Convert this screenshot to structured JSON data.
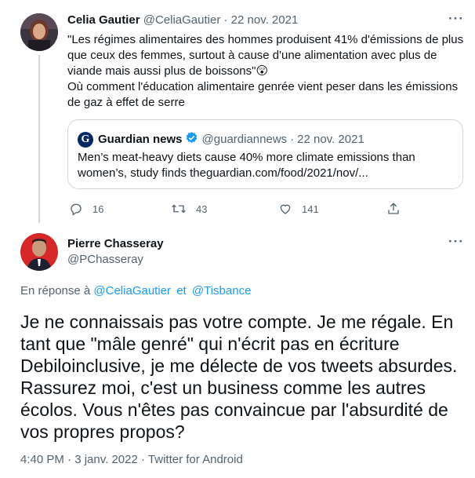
{
  "tweet1": {
    "author_name": "Celia Gautier",
    "handle": "@CeliaGautier",
    "dot": "·",
    "date": "22 nov. 2021",
    "more": "···",
    "text_lines": [
      "\"Les régimes alimentaires des hommes produisent 41% d'émissions de plus",
      "que ceux des femmes, surtout à cause d'une alimentation avec plus de",
      "viande mais aussi plus de boissons\"😲",
      "Où comment l'éducation alimentaire genrée vient peser dans les émissions",
      "de gaz à effet de serre"
    ],
    "quote": {
      "author_name": "Guardian news",
      "handle": "@guardiannews",
      "dot": "·",
      "date": "22 nov. 2021",
      "text_lines": [
        "Men’s meat-heavy diets cause 40% more climate emissions than",
        "women’s, study finds theguardian.com/food/2021/nov/..."
      ]
    },
    "actions": {
      "replies": "16",
      "retweets": "43",
      "likes": "141"
    }
  },
  "tweet2": {
    "author_name": "Pierre Chasseray",
    "handle": "@PChasseray",
    "more": "···",
    "reply_prefix": "En réponse à",
    "reply_to_1": "@CeliaGautier",
    "reply_and": "et",
    "reply_to_2": "@Tisbance",
    "text_lines": [
      "Je ne connaissais pas votre compte. Je me régale. En",
      "tant que \"mâle genré\" qui n'écrit pas en écriture",
      "Debiloinclusive, je me délecte de vos tweets absurdes.",
      "Rassurez moi, c'est un business comme les autres",
      "écolos. Vous n'êtes pas convaincue par l'absurdité de",
      "vos propres propos?"
    ],
    "time": "4:40 PM",
    "dot1": "·",
    "date": "3 janv. 2022",
    "dot2": "·",
    "source": "Twitter for Android"
  },
  "colors": {
    "link": "#1d9bf0",
    "secondary_text": "#536471",
    "border": "#cfd9de",
    "verified": "#1d9bf0"
  }
}
